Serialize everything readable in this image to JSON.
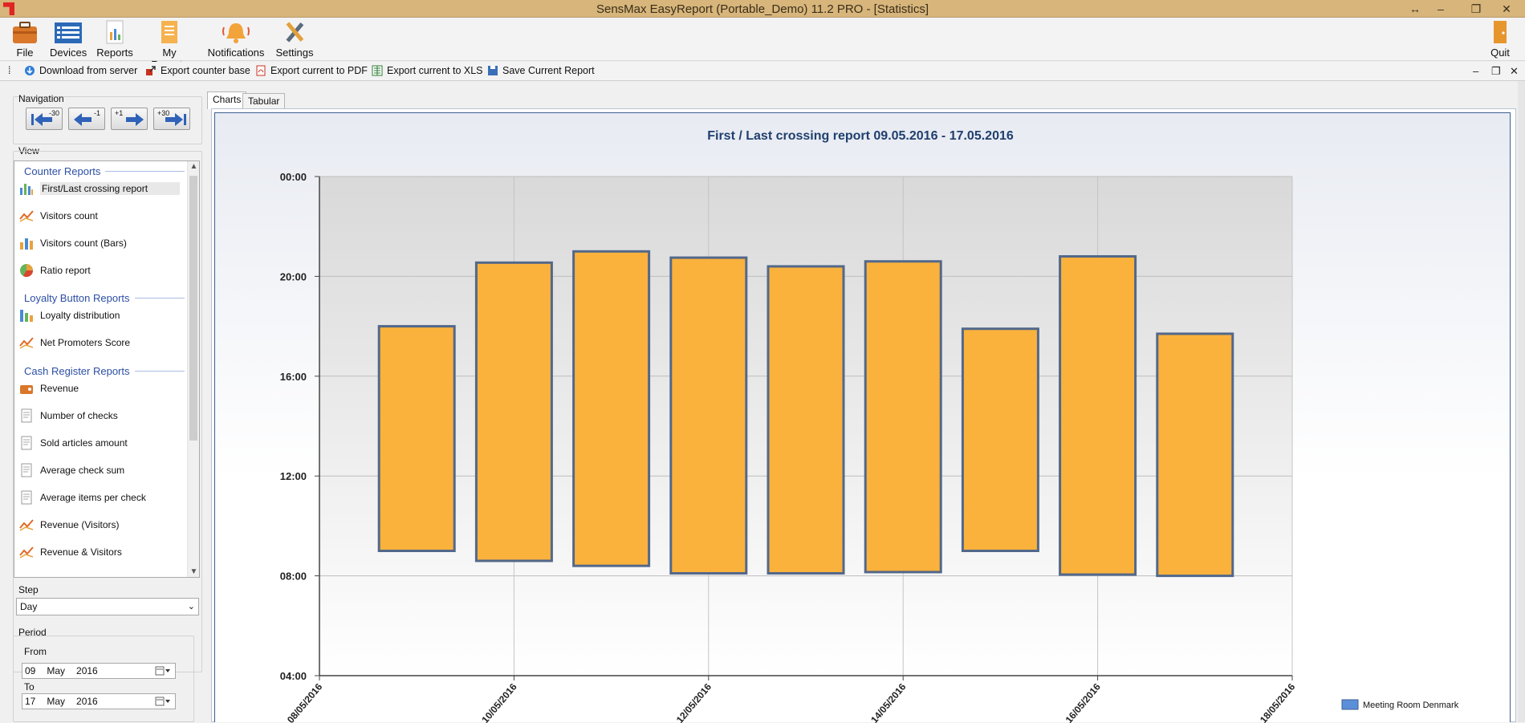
{
  "window": {
    "title": "SensMax EasyReport (Portable_Demo) 11.2 PRO - [Statistics]",
    "restore_icon": "double-arrow-icon",
    "maximize_icon": "restore-icon",
    "close_icon": "close-icon"
  },
  "ribbon": {
    "file": "File",
    "devices": "Devices",
    "reports": "Reports",
    "my_reports": "My Reports",
    "notifications": "Notifications",
    "settings": "Settings",
    "quit": "Quit"
  },
  "toolbar": {
    "download": "Download from server",
    "export_counter": "Export counter base",
    "export_pdf": "Export current to PDF",
    "export_xls": "Export current to XLS",
    "save_report": "Save Current Report"
  },
  "left": {
    "navigation_label": "Navigation",
    "nav_buttons": [
      "-30",
      "-1",
      "+1",
      "+30"
    ],
    "view_label": "View",
    "categories": [
      "Counter Reports",
      "Loyalty Button Reports",
      "Cash Register Reports"
    ],
    "items": [
      "First/Last crossing report",
      "Visitors count",
      "Visitors count (Bars)",
      "Ratio report",
      "Loyalty distribution",
      "Net Promoters Score",
      "Revenue",
      "Number of checks",
      "Sold articles amount",
      "Average check sum",
      "Average items per check",
      "Revenue (Visitors)",
      "Revenue & Visitors"
    ],
    "selected_item": "First/Last crossing report",
    "step_label": "Step",
    "step_value": "Day",
    "period_label": "Period",
    "from_label": "From",
    "from_day": "09",
    "from_month": "May",
    "from_year": "2016",
    "to_label": "To",
    "to_day": "17",
    "to_month": "May",
    "to_year": "2016"
  },
  "tabs": [
    "Charts",
    "Tabular"
  ],
  "active_tab": "Charts",
  "chart_data": {
    "type": "bar",
    "title": "First / Last crossing report 09.05.2016 - 17.05.2016",
    "xlabel": "",
    "ylabel": "",
    "categories": [
      "09/05/2016",
      "10/05/2016",
      "11/05/2016",
      "12/05/2016",
      "13/05/2016",
      "14/05/2016",
      "15/05/2016",
      "16/05/2016",
      "17/05/2016"
    ],
    "x_tick_labels": [
      "08/05/2016",
      "10/05/2016",
      "12/05/2016",
      "14/05/2016",
      "16/05/2016",
      "18/05/2016"
    ],
    "y_tick_labels": [
      "00:00",
      "20:00",
      "16:00",
      "12:00",
      "08:00",
      "04:00"
    ],
    "y_ticks_hours": [
      24,
      20,
      16,
      12,
      8,
      4
    ],
    "ylim_hours": [
      4,
      24
    ],
    "series": [
      {
        "name": "Meeting Room Denmark",
        "first_crossing_hours": [
          9.0,
          8.6,
          8.4,
          8.1,
          8.1,
          8.15,
          9.0,
          8.05,
          8.0
        ],
        "last_crossing_hours": [
          18.0,
          20.55,
          21.0,
          20.75,
          20.4,
          20.6,
          17.9,
          20.8,
          17.7
        ]
      }
    ],
    "bar_color": "#fab23d",
    "bar_border_color": "#52688a",
    "grid": true,
    "legend": "bottom-right"
  }
}
